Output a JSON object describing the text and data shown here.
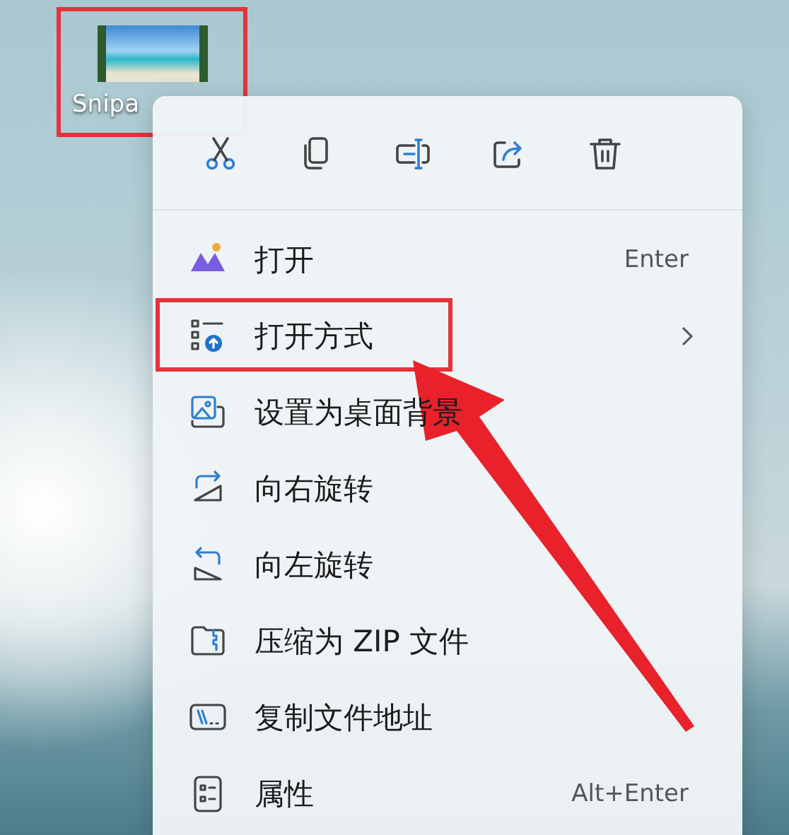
{
  "desktop_icon": {
    "label": "Snipa",
    "highlighted": true
  },
  "context_menu": {
    "toolbar": [
      {
        "kind": "cut"
      },
      {
        "kind": "copy"
      },
      {
        "kind": "rename"
      },
      {
        "kind": "share"
      },
      {
        "kind": "delete"
      }
    ],
    "items": [
      {
        "kind": "open",
        "label": "打开",
        "shortcut": "Enter",
        "submenu": false,
        "highlighted": false
      },
      {
        "kind": "open-with",
        "label": "打开方式",
        "submenu": true,
        "highlighted": true
      },
      {
        "kind": "wallpaper",
        "label": "设置为桌面背景",
        "submenu": false,
        "highlighted": false
      },
      {
        "kind": "rotate-right",
        "label": "向右旋转",
        "submenu": false,
        "highlighted": false
      },
      {
        "kind": "rotate-left",
        "label": "向左旋转",
        "submenu": false,
        "highlighted": false
      },
      {
        "kind": "zip",
        "label": "压缩为 ZIP 文件",
        "submenu": false,
        "highlighted": false
      },
      {
        "kind": "copy-path",
        "label": "复制文件地址",
        "submenu": false,
        "highlighted": false
      },
      {
        "kind": "properties",
        "label": "属性",
        "shortcut": "Alt+Enter",
        "submenu": false,
        "highlighted": false
      }
    ]
  },
  "annotation": {
    "arrow": true
  }
}
